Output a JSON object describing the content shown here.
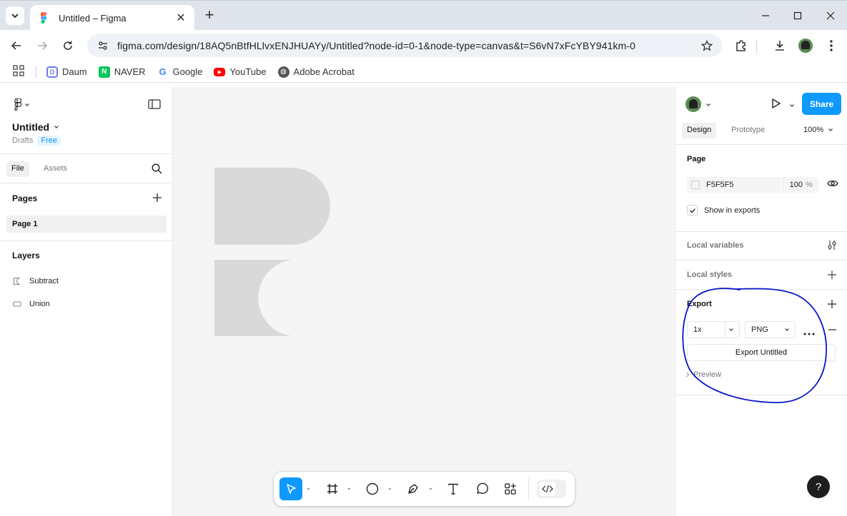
{
  "browser": {
    "tab_title": "Untitled – Figma",
    "url": "figma.com/design/18AQ5nBtfHLlvxENJHUAYy/Untitled?node-id=0-1&node-type=canvas&t=S6vN7xFcYBY941km-0",
    "bookmarks": [
      {
        "label": "Daum",
        "icon": "daum-icon",
        "color": "#6c7bf0"
      },
      {
        "label": "NAVER",
        "icon": "naver-icon",
        "color": "#03c75a"
      },
      {
        "label": "Google",
        "icon": "google-icon",
        "color": "#4285f4"
      },
      {
        "label": "YouTube",
        "icon": "youtube-icon",
        "color": "#ff0000"
      },
      {
        "label": "Adobe Acrobat",
        "icon": "globe-icon",
        "color": "#555555"
      }
    ]
  },
  "figma": {
    "file_name": "Untitled",
    "location": "Drafts",
    "plan_badge": "Free",
    "left_tabs": {
      "file": "File",
      "assets": "Assets"
    },
    "pages_header": "Pages",
    "pages": [
      "Page 1"
    ],
    "layers_header": "Layers",
    "layers": [
      {
        "name": "Subtract",
        "icon": "subtract-icon"
      },
      {
        "name": "Union",
        "icon": "union-icon"
      }
    ],
    "right": {
      "share_label": "Share",
      "tabs": {
        "design": "Design",
        "prototype": "Prototype"
      },
      "zoom": "100%",
      "page_section": "Page",
      "page_color": "F5F5F5",
      "page_opacity": "100",
      "percent_sign": "%",
      "show_in_exports": "Show in exports",
      "local_variables": "Local variables",
      "local_styles": "Local styles",
      "export_section": "Export",
      "export_scale": "1x",
      "export_format": "PNG",
      "export_button": "Export Untitled",
      "preview": "Preview"
    },
    "help": "?",
    "colors": {
      "accent": "#0d99ff",
      "annotation": "#0a16c8",
      "shape_fill": "#d9d9d9",
      "canvas": "#f5f5f5"
    }
  }
}
